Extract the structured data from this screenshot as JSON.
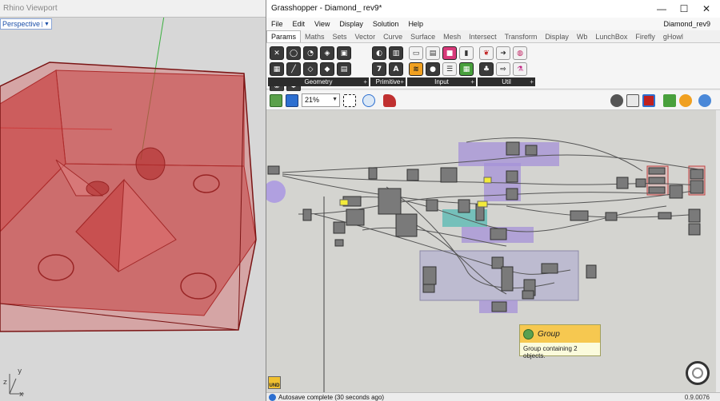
{
  "rhino": {
    "title": "Rhino Viewport",
    "viewport_name": "Perspective",
    "axis_x": "x",
    "axis_y": "y",
    "axis_z": "z"
  },
  "grasshopper": {
    "title": "Grasshopper - Diamond_ rev9*",
    "document_name": "Diamond_rev9",
    "window_controls": {
      "minimize": "—",
      "maximize": "☐",
      "close": "✕"
    },
    "menu": [
      "File",
      "Edit",
      "View",
      "Display",
      "Solution",
      "Help"
    ],
    "tabs": [
      "Params",
      "Maths",
      "Sets",
      "Vector",
      "Curve",
      "Surface",
      "Mesh",
      "Intersect",
      "Transform",
      "Display",
      "Wb",
      "LunchBox",
      "Firefly",
      "gHowl"
    ],
    "active_tab": "Params",
    "ribbon_panels": [
      {
        "label": "Geometry",
        "plus": "+"
      },
      {
        "label": "Primitive",
        "plus": "+"
      },
      {
        "label": "Input",
        "plus": "+"
      },
      {
        "label": "Util",
        "plus": "+"
      }
    ],
    "primitive_letters": [
      "7",
      "A"
    ],
    "zoom": "21%",
    "tooltip": {
      "title": "Group",
      "text": "Group containing 2 objects."
    },
    "undo_label": "UND",
    "status": "Autosave complete (30 seconds ago)",
    "version": "0.9.0076"
  },
  "colors": {
    "group_purple": "#a592d8",
    "group_grey": "#b7b4cf",
    "tooltip_yellow": "#f6c850",
    "box_red": "#c8262a"
  }
}
